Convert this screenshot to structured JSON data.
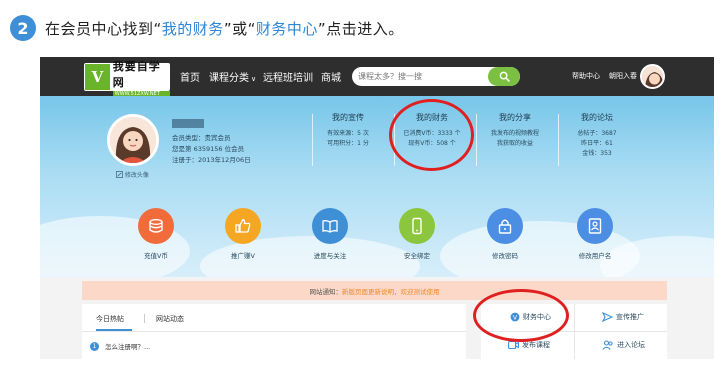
{
  "instruction": {
    "step": "2",
    "lead": "在会员中心找到",
    "quote_open_1": "“",
    "link1": "我的财务",
    "quote_close_1": "”",
    "or": "或",
    "quote_open_2": "“",
    "link2": "财务中心",
    "quote_close_2": "”",
    "tail": "点击进入。"
  },
  "colors": {
    "step_badge": "#3e8fd6",
    "highlight_text": "#2f86d3",
    "nav_bg": "#2e2e2e",
    "ring": "#e02020",
    "notice_bg": "#fbd8c8",
    "notice_msg": "#f08a2e"
  },
  "navbar": {
    "logo_mark": "V",
    "logo_name": "我要自学网",
    "logo_url": "WWW.51ZXW.NET",
    "items": [
      "首页",
      "课程分类",
      "远程班培训",
      "商城"
    ],
    "category_caret": "∨",
    "search_placeholder": "课程太多？搜一搜",
    "search_icon": "search-icon",
    "help": "帮助中心",
    "username": "朝阳入春"
  },
  "profile": {
    "edit_avatar": "修改头像",
    "member_type": "会员类型：贵宾会员",
    "rank": "您是第 6359156 位会员",
    "register_time": "注册于：2013年12月06日"
  },
  "stats": [
    {
      "title": "我的宣传",
      "lines": [
        "有效来源：5 次",
        "可用积分：1 分"
      ]
    },
    {
      "title": "我的财务",
      "lines": [
        "已消费V币：3333 个",
        "现有V币：508 个"
      ]
    },
    {
      "title": "我的分享",
      "lines": [
        "我发布的视频教程",
        "我获取的收益"
      ]
    },
    {
      "title": "我的论坛",
      "lines": [
        "总帖子：3687",
        "昨日平：61",
        "金钱：353"
      ]
    }
  ],
  "features": [
    {
      "label": "充值V币",
      "icon": "coins-icon",
      "color": "#f26b3a"
    },
    {
      "label": "推广赚V",
      "icon": "thumbs-up-icon",
      "color": "#f5a623"
    },
    {
      "label": "进度与关注",
      "icon": "book-icon",
      "color": "#3e8fd6"
    },
    {
      "label": "安全绑定",
      "icon": "phone-icon",
      "color": "#8cc63f"
    },
    {
      "label": "修改密码",
      "icon": "lock-icon",
      "color": "#4c8ee3"
    },
    {
      "label": "修改用户名",
      "icon": "id-card-icon",
      "color": "#4c8ee3"
    }
  ],
  "notice": {
    "lead": "网站通知：",
    "message": "新版页面更新说明，欢迎测试使用"
  },
  "tabs": [
    "今日热帖",
    "网站动态"
  ],
  "posts": [
    {
      "index": "1",
      "title": "怎么注册啊？..."
    }
  ],
  "actions": {
    "finance_center": "财务中心",
    "promote": "宣传推广",
    "publish_course": "发布课程",
    "enter_forum": "进入论坛"
  }
}
